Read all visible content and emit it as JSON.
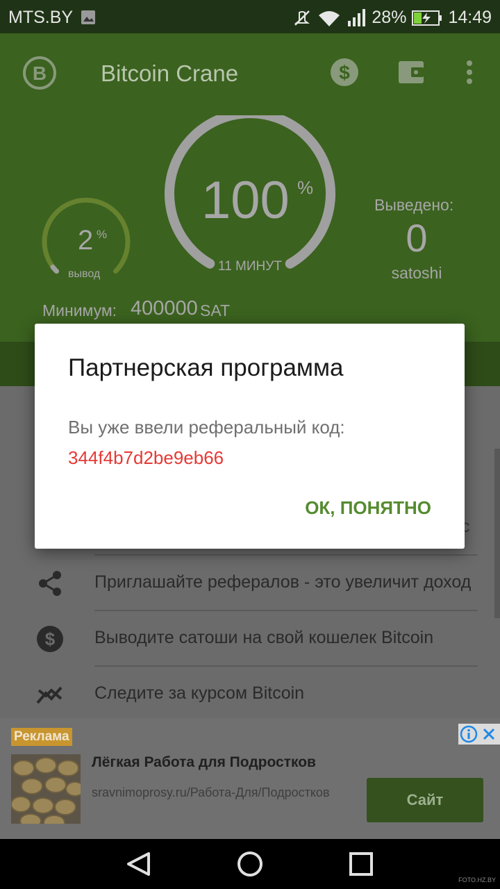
{
  "status_bar": {
    "carrier": "MTS.BY",
    "battery": "28%",
    "time": "14:49"
  },
  "app_bar": {
    "title": "Bitcoin Crane"
  },
  "main_gauge": {
    "value": "100",
    "unit": "%",
    "sub": "11 МИНУТ",
    "fill_fraction": 0.0
  },
  "small_gauge": {
    "value": "2",
    "unit": "%",
    "sub": "вывод",
    "fill_fraction": 0.02
  },
  "withdrawn": {
    "label": "Выведено:",
    "value": "0",
    "unit": "satoshi"
  },
  "minimum": {
    "label": "Минимум:",
    "value": "400000",
    "unit": "SAT"
  },
  "list": {
    "items": [
      {
        "label": "c",
        "icon": "blank-icon"
      },
      {
        "label": "Приглашайте рефералов - это увеличит доход",
        "icon": "share-icon"
      },
      {
        "label": "Выводите сатоши на свой кошелек Bitcoin",
        "icon": "dollar-icon"
      },
      {
        "label": "Следите за курсом Bitcoin",
        "icon": "trend-icon"
      }
    ]
  },
  "ad": {
    "badge": "Реклама",
    "title": "Лёгкая Работа для Подростков",
    "url": "sravnimoprosy.ru/Работа-Для/Подростков",
    "button": "Сайт"
  },
  "dialog": {
    "title": "Партнерская программа",
    "message": "Вы уже ввели реферальный код:",
    "code": "344f4b7d2be9eb66",
    "ok_button": "ОК, ПОНЯТНО"
  },
  "watermark": "FOTO.HZ.BY",
  "colors": {
    "header": "#3b621f",
    "accent": "#558b2f",
    "code": "#e53935",
    "ad_badge": "#c8952f"
  }
}
